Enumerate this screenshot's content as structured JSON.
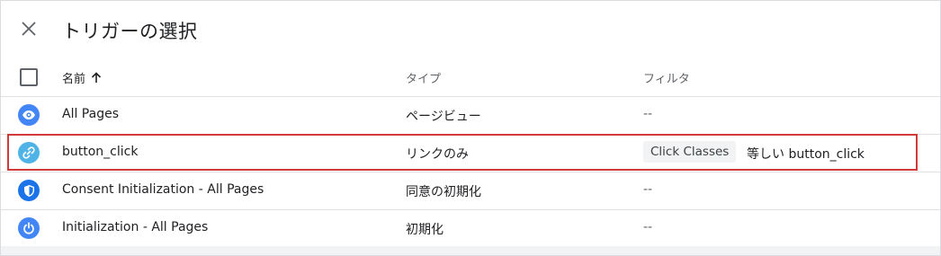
{
  "dialog": {
    "title": "トリガーの選択",
    "close_label": "×"
  },
  "table": {
    "columns": {
      "name": "名前",
      "name_sort": "ascending",
      "type": "タイプ",
      "filter": "フィルタ"
    },
    "rows": [
      {
        "name": "All Pages",
        "type": "ページビュー",
        "filter": "--",
        "icon": "eye-icon",
        "icon_color": "#4285f4"
      },
      {
        "name": "button_click",
        "type": "リンクのみ",
        "filter_chip": "Click Classes",
        "filter_text": "等しい button_click",
        "icon": "link-icon",
        "icon_color": "#4fb3e8",
        "highlighted": true
      },
      {
        "name": "Consent Initialization - All Pages",
        "type": "同意の初期化",
        "filter": "--",
        "icon": "shield-icon",
        "icon_color": "#1a73e8"
      },
      {
        "name": "Initialization - All Pages",
        "type": "初期化",
        "filter": "--",
        "icon": "power-icon",
        "icon_color": "#4285f4"
      }
    ]
  },
  "colors": {
    "highlight_border": "#d23a3a",
    "icon_blue": "#4285f4"
  }
}
